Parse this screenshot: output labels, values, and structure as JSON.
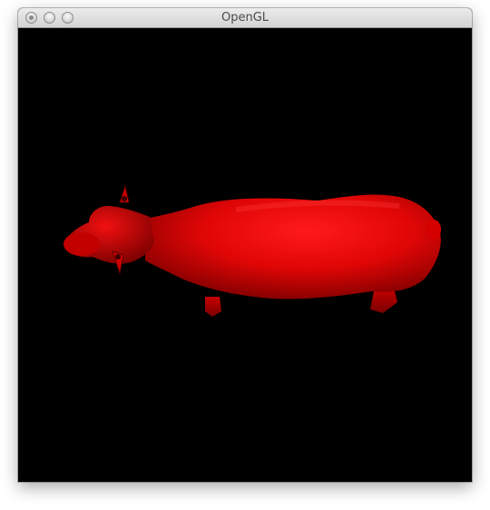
{
  "window": {
    "title": "OpenGL"
  },
  "titlebar": {
    "buttons": [
      {
        "name": "close-button",
        "icon": "close-icon"
      },
      {
        "name": "minimize-button",
        "icon": "minimize-icon"
      },
      {
        "name": "zoom-button",
        "icon": "zoom-icon"
      }
    ]
  },
  "scene": {
    "background_color": "#000000",
    "model": "cow",
    "model_color": "#e00000"
  }
}
